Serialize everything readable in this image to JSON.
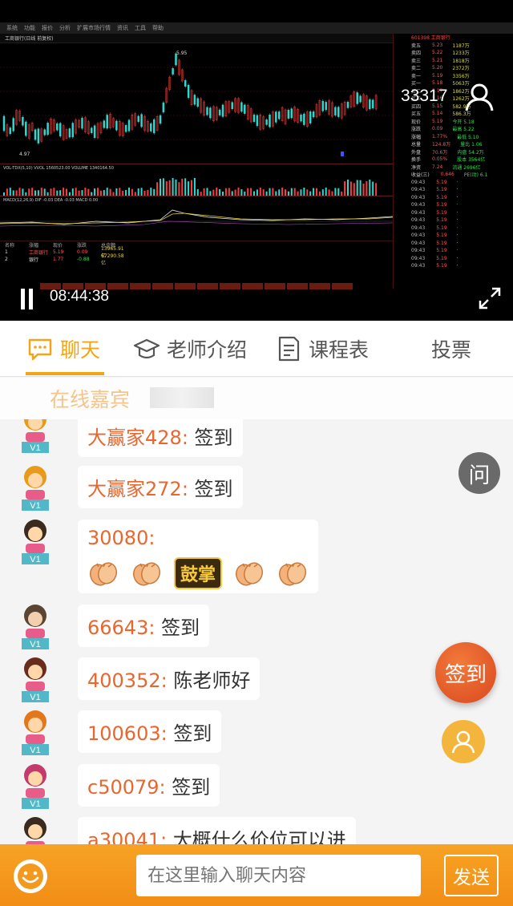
{
  "video": {
    "menu": [
      "系统",
      "功能",
      "报价",
      "分析",
      "扩展市场行情",
      "资讯",
      "工具",
      "帮助"
    ],
    "stock_title": "工商银行(日线 前复权)",
    "stock_code": "601398 工商银行",
    "viewer_count": "33317",
    "timestamp": "08:44:38",
    "high_label": "5.95",
    "low_label": "4.97",
    "indicator_vol": "VOL-TDX(5,10)  VVOL 1560523.00  VOLUME 1340164.50",
    "indicator_macd": "MACD(12,26,9) DIF -0.03 DEA -0.03 MACD 0.00",
    "quote_rows": [
      {
        "label": "卖五",
        "price": "5.23",
        "vol": "1187万"
      },
      {
        "label": "卖四",
        "price": "5.22",
        "vol": "1233万"
      },
      {
        "label": "卖三",
        "price": "5.21",
        "vol": "1818万"
      },
      {
        "label": "卖二",
        "price": "5.20",
        "vol": "2372万"
      },
      {
        "label": "卖一",
        "price": "5.19",
        "vol": "3356万"
      },
      {
        "label": "买一",
        "price": "5.18",
        "vol": "5063万"
      },
      {
        "label": "买二",
        "price": "5.17",
        "vol": "1862万"
      },
      {
        "label": "买三",
        "price": "5.16",
        "vol": "1262万"
      },
      {
        "label": "买四",
        "price": "5.15",
        "vol": "582.9万"
      },
      {
        "label": "买五",
        "price": "5.14",
        "vol": "586.3万"
      },
      {
        "label": "现价",
        "price": "5.19",
        "vol": "今开 5.18"
      },
      {
        "label": "涨跌",
        "price": "0.09",
        "vol": "最高 5.22"
      },
      {
        "label": "涨幅",
        "price": "1.77%",
        "vol": "最低 5.10"
      },
      {
        "label": "总量",
        "price": "124.8万",
        "vol": "量比 1.06"
      },
      {
        "label": "外盘",
        "price": "70.6万",
        "vol": "内盘 54.2万"
      },
      {
        "label": "换手",
        "price": "0.05%",
        "vol": "股本 3564亿"
      },
      {
        "label": "净资",
        "price": "7.24",
        "vol": "流通 2696亿"
      },
      {
        "label": "收益(三)",
        "price": "0.646",
        "vol": "PE(动) 6.1"
      }
    ],
    "table_rows": [
      {
        "idx": "1",
        "name": "工商银行",
        "price": "5.19",
        "chg": "0.09",
        "amt": "13965.91亿"
      },
      {
        "idx": "2",
        "name": "银行",
        "price": "1.77",
        "chg": "-0.88",
        "amt": "67290.58亿"
      }
    ]
  },
  "tabs": {
    "chat": "聊天",
    "teacher": "老师介绍",
    "schedule": "课程表",
    "vote": "投票"
  },
  "guest_label": "在线嘉宾",
  "messages": [
    {
      "name": "大赢家428",
      "text": "签到",
      "level": "V1"
    },
    {
      "name": "大赢家272",
      "text": "签到",
      "level": "V1"
    },
    {
      "name": "30080",
      "text": "",
      "level": "V1",
      "sticker": "鼓掌"
    },
    {
      "name": "66643",
      "text": "签到",
      "level": "V1"
    },
    {
      "name": "400352",
      "text": "陈老师好",
      "level": "V1"
    },
    {
      "name": "100603",
      "text": "签到",
      "level": "V1"
    },
    {
      "name": "c50079",
      "text": "签到",
      "level": "V1"
    },
    {
      "name": "a30041",
      "text": "大概什么价位可以进",
      "level": "V1"
    }
  ],
  "floating": {
    "ask": "问",
    "checkin": "签到"
  },
  "input": {
    "placeholder": "在这里输入聊天内容",
    "send": "发送"
  },
  "colors": {
    "accent": "#f3a516",
    "name": "#e9662e",
    "checkin": "#d9481f"
  }
}
